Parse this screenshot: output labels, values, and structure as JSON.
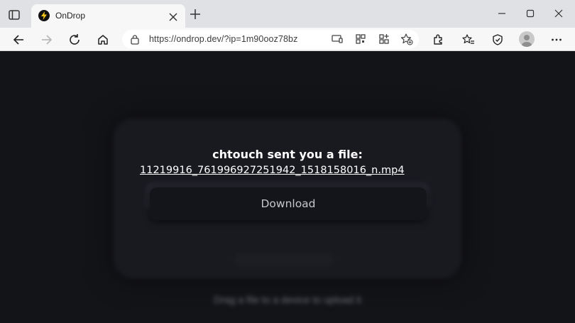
{
  "browser": {
    "tab": {
      "title": "OnDrop",
      "favicon": "lightning-bolt-icon",
      "favicon_color": "#f5c518"
    },
    "address_bar": {
      "url": "https://ondrop.dev/?ip=1m90ooz78bz"
    }
  },
  "page": {
    "sender_message": "chtouch sent you a file:",
    "file_name": "11219916_761996927251942_1518158016_n.mp4",
    "download_label": "Download",
    "background_hint": "Drag a file to a device to upload it"
  },
  "colors": {
    "page_background": "#131418",
    "chrome_background": "#dfe1e5",
    "toolbar_background": "#f7f7f7"
  }
}
